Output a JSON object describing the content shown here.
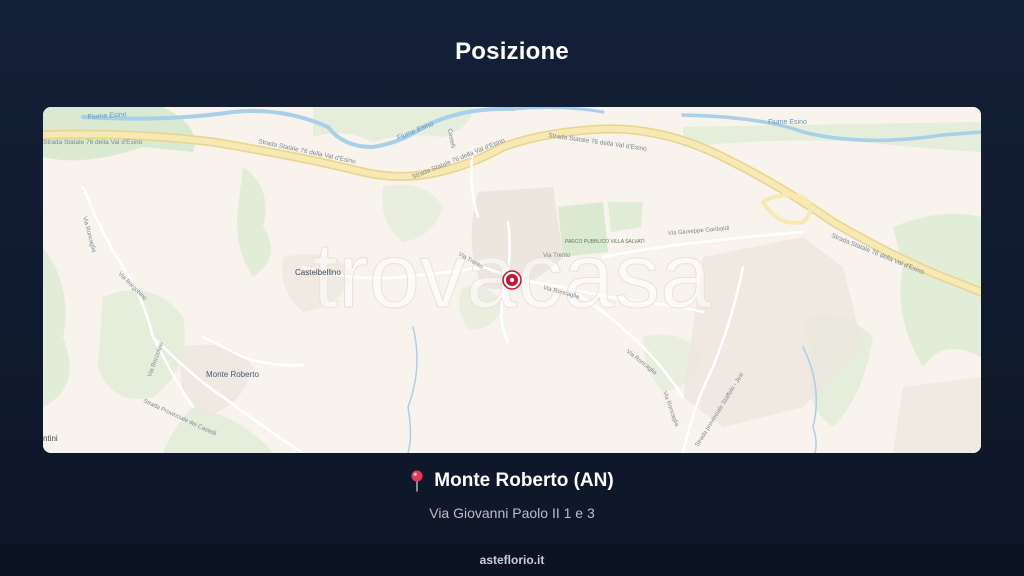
{
  "header": {
    "title": "Posizione"
  },
  "map": {
    "watermark": "trovacasa",
    "labels": {
      "river_1": "Fiume Esino",
      "river_2": "Fiume Esino",
      "river_3": "Fiume Esino",
      "highway_1": "Strada Statale 76 della Val d'Esino",
      "highway_2": "Strada Statale 76 della Val d'Esino",
      "highway_3": "Strada Statale 76 della Val d'Esino",
      "highway_4": "Strada Statale 76 della Val d'Esino",
      "town_castelbellino": "Castelbellino",
      "town_monte_roberto": "Monte Roberto",
      "town_edge": "ntini",
      "street_roncaglia": "Via Roncaglia",
      "street_borgobino": "Via Borgobino",
      "street_boccolino": "Via Boccolino",
      "street_castelli": "Strada Provinciale dei Castelli",
      "street_roncaglia_2": "Via Roncaglia",
      "street_roncaglia_3": "Via Roncaglia",
      "street_garibaldi": "Via Giuseppe Garibaldi",
      "street_sp": "Strada provinciale Staffolo - Jesi",
      "street_trento": "Via Trento",
      "park": "PARCO PUBBLICO VILLA SALVATI",
      "street_castelli_2": "Castelli"
    },
    "marker": "property-marker"
  },
  "location": {
    "title": "Monte Roberto (AN)",
    "address": "Via Giovanni Paolo II 1 e 3",
    "pin_icon": "map-pin-icon"
  },
  "footer": {
    "site": "asteflorio.it"
  },
  "colors": {
    "background": "#121c31",
    "footer_bg": "#0b1220",
    "map_base": "#f8f3ec",
    "green": "#d9ead0",
    "road_yellow": "#f5e3a3",
    "river": "#a8d0e8",
    "marker_red": "#c41230"
  }
}
